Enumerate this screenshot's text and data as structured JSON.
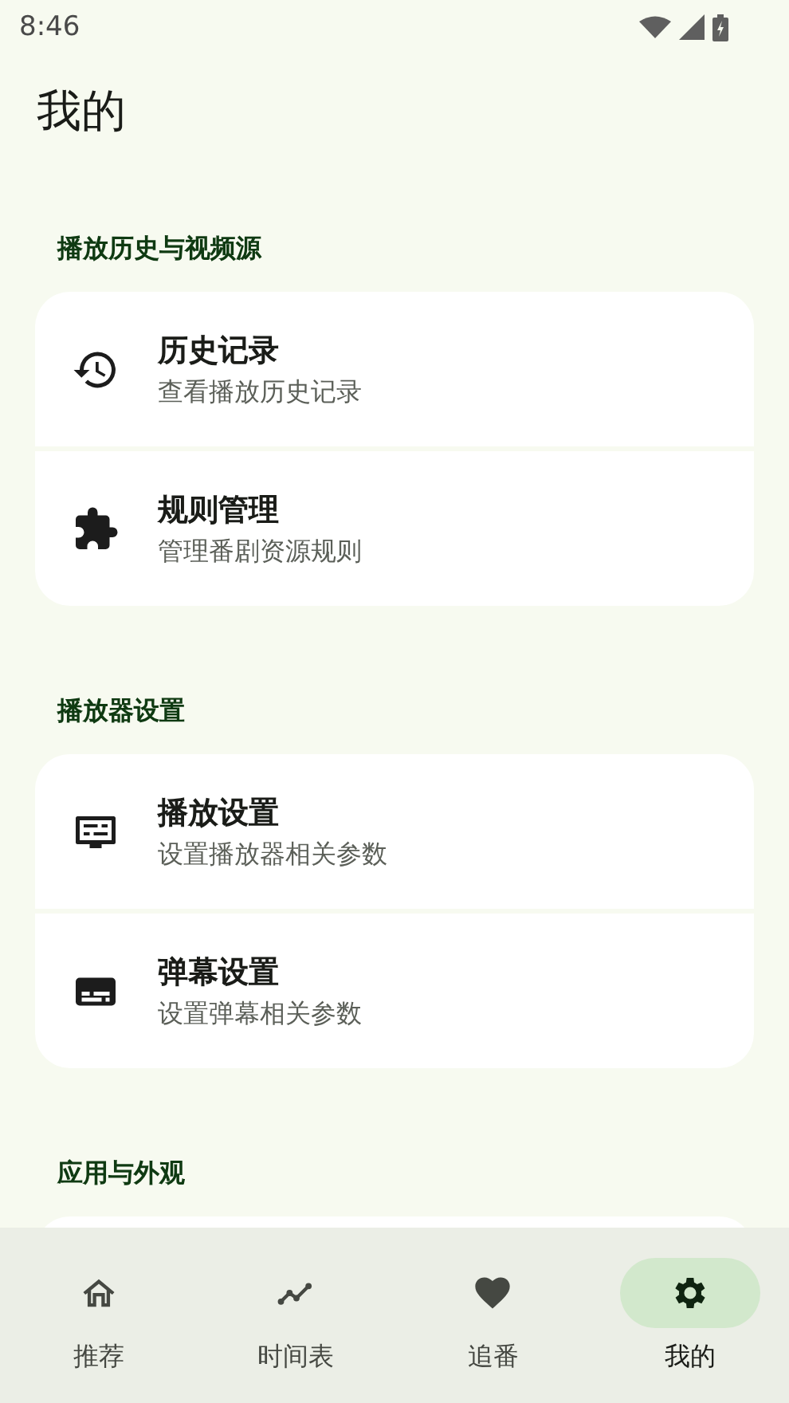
{
  "status_bar": {
    "time": "8:46"
  },
  "page_title": "我的",
  "sections": [
    {
      "title": "播放历史与视频源",
      "items": [
        {
          "title": "历史记录",
          "subtitle": "查看播放历史记录"
        },
        {
          "title": "规则管理",
          "subtitle": "管理番剧资源规则"
        }
      ]
    },
    {
      "title": "播放器设置",
      "items": [
        {
          "title": "播放设置",
          "subtitle": "设置播放器相关参数"
        },
        {
          "title": "弹幕设置",
          "subtitle": "设置弹幕相关参数"
        }
      ]
    },
    {
      "title": "应用与外观"
    }
  ],
  "nav": [
    {
      "label": "推荐",
      "selected": false
    },
    {
      "label": "时间表",
      "selected": false
    },
    {
      "label": "追番",
      "selected": false
    },
    {
      "label": "我的",
      "selected": true
    }
  ]
}
